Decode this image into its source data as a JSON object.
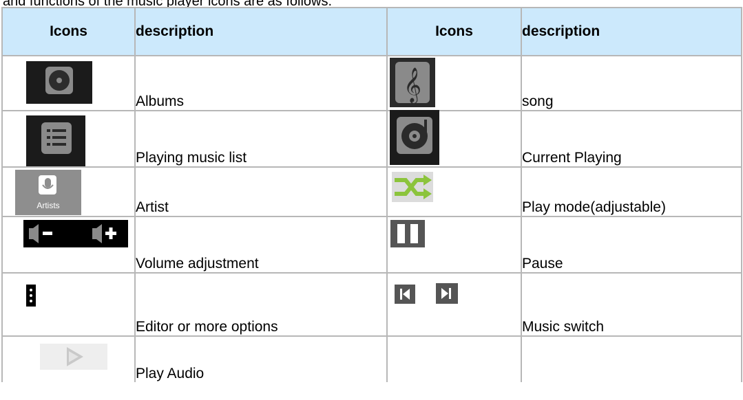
{
  "table": {
    "headers": {
      "icons_1": "Icons",
      "description_1": "description",
      "icons_2": "Icons",
      "description_2": "description"
    },
    "rows": [
      {
        "left_icon": "albums-icon",
        "left_description": "Albums",
        "right_icon": "song-icon",
        "right_description": "song"
      },
      {
        "left_icon": "playing-list-icon",
        "left_description": "Playing music list",
        "right_icon": "current-playing-icon",
        "right_description": "Current Playing"
      },
      {
        "left_icon": "artists-icon",
        "left_icon_caption": "Artists",
        "left_description": "Artist",
        "right_icon": "shuffle-icon",
        "right_description": "Play mode(adjustable)"
      },
      {
        "left_icon": "volume-icon",
        "left_description": "Volume adjustment",
        "right_icon": "pause-icon",
        "right_description": "Pause"
      },
      {
        "left_icon": "more-options-icon",
        "left_description": "Editor or more options",
        "right_icon": "previous-next-icon",
        "right_description": "Music switch"
      },
      {
        "left_icon": "play-icon",
        "left_description": "Play Audio",
        "right_icon": "",
        "right_description": ""
      }
    ]
  },
  "colors": {
    "header_bg": "#cce9fc",
    "grid": "#b7b7b7",
    "icon_dark": "#1b1b1b",
    "icon_gray": "#8a8a8a",
    "shuffle_green": "#8cc43c"
  }
}
